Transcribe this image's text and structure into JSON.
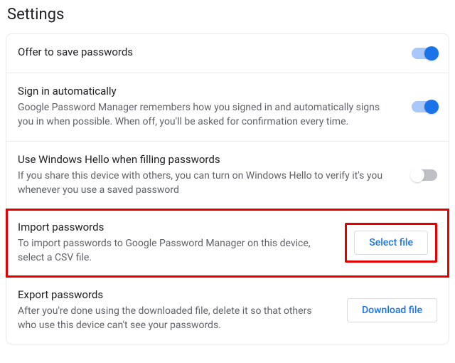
{
  "page_title": "Settings",
  "rows": {
    "offer_save": {
      "title": "Offer to save passwords",
      "toggle_on": true
    },
    "signin_auto": {
      "title": "Sign in automatically",
      "desc": "Google Password Manager remembers how you signed in and automatically signs you in when possible. When off, you'll be asked for confirmation every time.",
      "toggle_on": true
    },
    "win_hello": {
      "title": "Use Windows Hello when filling passwords",
      "desc": "If you share this device with others, you can turn on Windows Hello to verify it's you whenever you use a saved password",
      "toggle_on": false
    },
    "import_pw": {
      "title": "Import passwords",
      "desc": "To import passwords to Google Password Manager on this device, select a CSV file.",
      "button": "Select file"
    },
    "export_pw": {
      "title": "Export passwords",
      "desc": "After you're done using the downloaded file, delete it so that others who use this device can't see your passwords.",
      "button": "Download file"
    }
  }
}
